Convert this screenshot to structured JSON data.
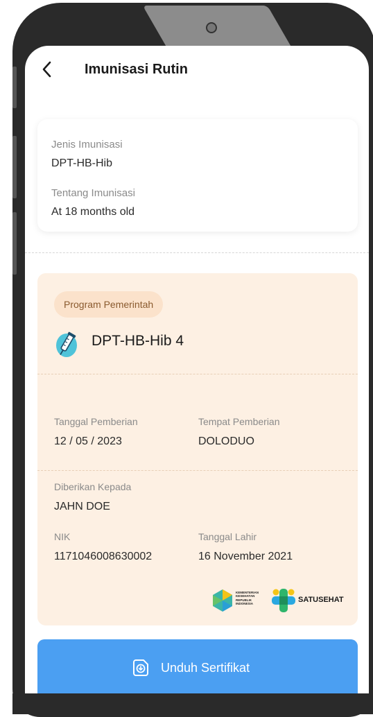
{
  "header": {
    "title": "Imunisasi Rutin",
    "back_icon": "chevron-left-icon"
  },
  "info": {
    "type_label": "Jenis Imunisasi",
    "type_value": "DPT-HB-Hib",
    "about_label": "Tentang Imunisasi",
    "about_value": "At 18 months old"
  },
  "certificate": {
    "badge": "Program Pemerintah",
    "vaccine_icon": "syringe-icon",
    "vaccine_name": "DPT-HB-Hib 4",
    "date_label": "Tanggal Pemberian",
    "date_value": "12 / 05 / 2023",
    "place_label": "Tempat Pemberian",
    "place_value": "DOLODUO",
    "recipient_label": "Diberikan Kepada",
    "recipient_value": "JAHN DOE",
    "nik_label": "NIK",
    "nik_value": "1171046008630002",
    "dob_label": "Tanggal Lahir",
    "dob_value": "16 November 2021",
    "logo_kemenkes_text": "KEMENTERIAN KESEHATAN REPUBLIK INDONESIA",
    "logo_satusehat_text": "SATUSEHAT"
  },
  "download": {
    "label": "Unduh Sertifikat",
    "icon": "download-certificate-icon"
  },
  "colors": {
    "accent": "#4b9ff2",
    "card_bg": "#fdf0e3",
    "badge_bg": "#fbe2cb"
  }
}
